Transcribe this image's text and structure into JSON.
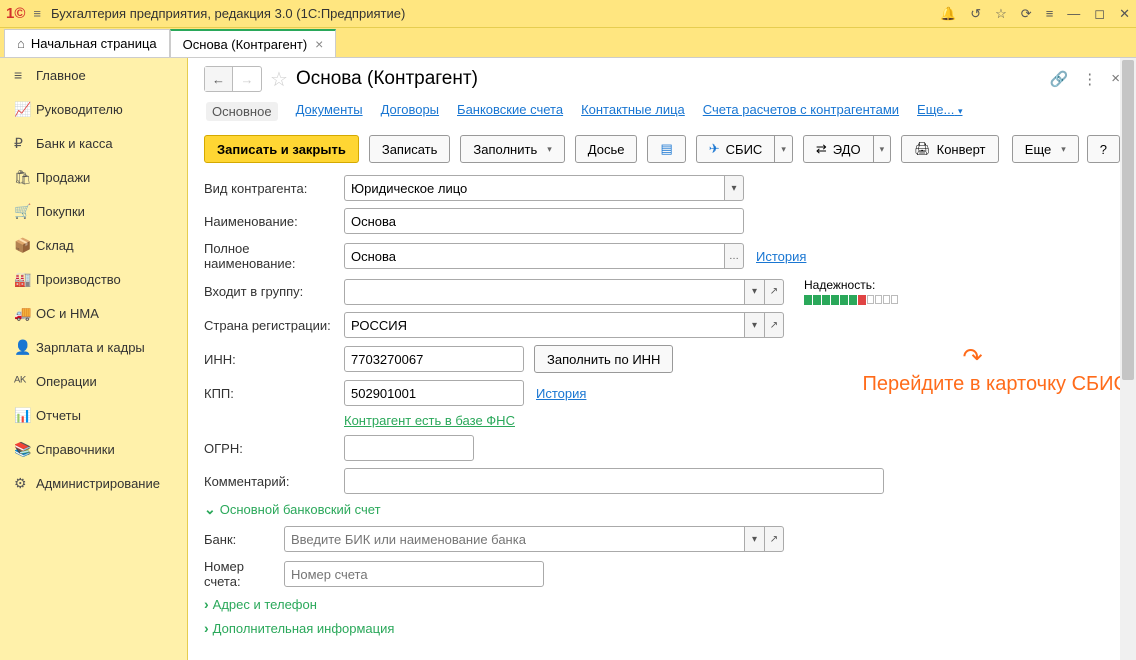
{
  "titlebar": {
    "title": "Бухгалтерия предприятия, редакция 3.0  (1С:Предприятие)"
  },
  "tabs": {
    "home": "Начальная страница",
    "active": "Основа (Контрагент)"
  },
  "sidebar": [
    {
      "icon": "≡",
      "label": "Главное"
    },
    {
      "icon": "📈",
      "label": "Руководителю"
    },
    {
      "icon": "₽",
      "label": "Банк и касса"
    },
    {
      "icon": "🛍",
      "label": "Продажи"
    },
    {
      "icon": "🛒",
      "label": "Покупки"
    },
    {
      "icon": "📦",
      "label": "Склад"
    },
    {
      "icon": "🏭",
      "label": "Производство"
    },
    {
      "icon": "🚚",
      "label": "ОС и НМА"
    },
    {
      "icon": "👤",
      "label": "Зарплата и кадры"
    },
    {
      "icon": "ᴬᴷ",
      "label": "Операции"
    },
    {
      "icon": "📊",
      "label": "Отчеты"
    },
    {
      "icon": "📚",
      "label": "Справочники"
    },
    {
      "icon": "⚙",
      "label": "Администрирование"
    }
  ],
  "page": {
    "title": "Основа (Контрагент)"
  },
  "sections": {
    "main": "Основное",
    "docs": "Документы",
    "contracts": "Договоры",
    "bank": "Банковские счета",
    "contacts": "Контактные лица",
    "accounts": "Счета расчетов с контрагентами",
    "more": "Еще..."
  },
  "toolbar": {
    "save_close": "Записать и закрыть",
    "save": "Записать",
    "fill": "Заполнить",
    "dossier": "Досье",
    "sbis": "СБИС",
    "edo": "ЭДО",
    "konvert": "Конверт",
    "more": "Еще",
    "help": "?"
  },
  "fields": {
    "type_label": "Вид контрагента:",
    "type_value": "Юридическое лицо",
    "name_label": "Наименование:",
    "name_value": "Основа",
    "fullname_label": "Полное наименование:",
    "fullname_value": "Основа",
    "history_link": "История",
    "group_label": "Входит в группу:",
    "country_label": "Страна регистрации:",
    "country_value": "РОССИЯ",
    "inn_label": "ИНН:",
    "inn_value": "7703270067",
    "fill_inn_btn": "Заполнить по ИНН",
    "kpp_label": "КПП:",
    "kpp_value": "502901001",
    "fns_link": "Контрагент есть в базе ФНС",
    "ogrn_label": "ОГРН:",
    "comment_label": "Комментарий:",
    "reliability_label": "Надежность:"
  },
  "bank_section": {
    "title": "Основной банковский счет",
    "bank_label": "Банк:",
    "bank_placeholder": "Введите БИК или наименование банка",
    "accnum_label": "Номер счета:",
    "accnum_placeholder": "Номер счета"
  },
  "expand": {
    "address": "Адрес и телефон",
    "additional": "Дополнительная информация"
  },
  "annotation": "Перейдите в карточку СБИС"
}
